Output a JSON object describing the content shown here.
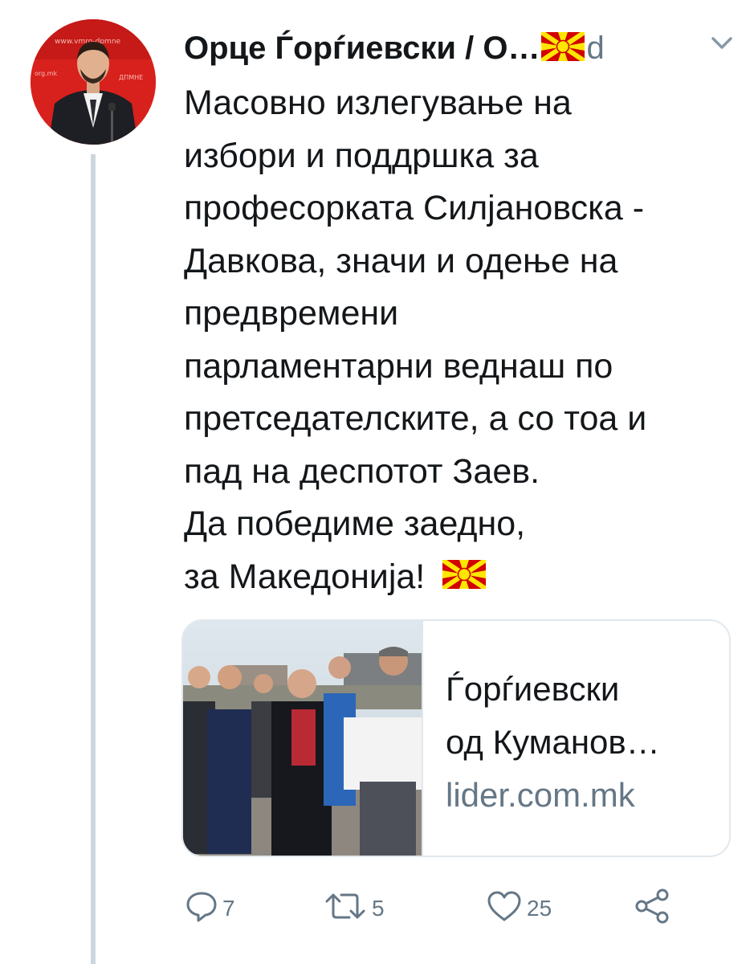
{
  "tweet": {
    "author_display": "Орце Ѓорѓиевски / О…",
    "time": "d",
    "lines": [
      "Масовно излегување на",
      "избори и поддршка за",
      "професорката Силјановска -",
      "Давкова, значи и одење на",
      "предвремени",
      "парламентарни веднаш по",
      "претседателските, а со тоа и",
      "пад на деспотот Заев.",
      "Да победиме заедно,",
      "за Македонија!"
    ]
  },
  "card": {
    "title_lines": [
      "Ѓорѓиевски",
      "од Куманов…"
    ],
    "domain": "lider.com.mk"
  },
  "actions": {
    "replies": "7",
    "retweets": "5",
    "likes": "25"
  },
  "icons": {
    "avatar": "avatar",
    "flag": "macedonia-flag-icon",
    "chevron": "chevron-down-icon",
    "reply": "reply-icon",
    "retweet": "retweet-icon",
    "like": "heart-icon",
    "share": "share-icon"
  },
  "colors": {
    "text": "#14171a",
    "secondary": "#657786",
    "border": "#e1e8ed",
    "thread_line": "#ccd6dd",
    "flag_red": "#d20000",
    "flag_yellow": "#ffe600"
  }
}
